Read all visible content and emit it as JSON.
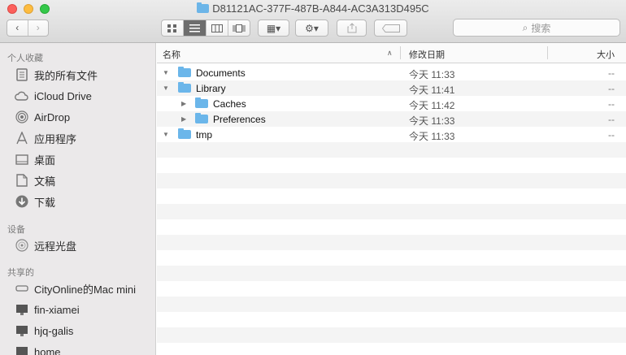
{
  "window": {
    "title": "D81121AC-377F-487B-A844-AC3A313D495C"
  },
  "toolbar": {
    "back": "‹",
    "forward": "›",
    "view_icon": "☰",
    "arrange_label": "▦▾",
    "action_label": "⚙▾",
    "search_placeholder": "搜索"
  },
  "sidebar": {
    "favorites_heading": "个人收藏",
    "favorites": [
      {
        "label": "我的所有文件",
        "icon": "all-files-icon"
      },
      {
        "label": "iCloud Drive",
        "icon": "cloud-icon"
      },
      {
        "label": "AirDrop",
        "icon": "airdrop-icon"
      },
      {
        "label": "应用程序",
        "icon": "applications-icon"
      },
      {
        "label": "桌面",
        "icon": "desktop-icon"
      },
      {
        "label": "文稿",
        "icon": "documents-icon"
      },
      {
        "label": "下载",
        "icon": "download-icon"
      }
    ],
    "devices_heading": "设备",
    "devices": [
      {
        "label": "远程光盘",
        "icon": "disc-icon"
      }
    ],
    "shared_heading": "共享的",
    "shared": [
      {
        "label": "CityOnline的Mac mini",
        "icon": "mac-mini-icon"
      },
      {
        "label": "fin-xiamei",
        "icon": "monitor-icon"
      },
      {
        "label": "hjq-galis",
        "icon": "monitor-icon"
      },
      {
        "label": "home",
        "icon": "monitor-icon"
      }
    ]
  },
  "columns": {
    "name": "名称",
    "date": "修改日期",
    "size": "大小"
  },
  "files": [
    {
      "name": "Documents",
      "date": "今天 11:33",
      "size": "--"
    },
    {
      "name": "Library",
      "date": "今天 11:41",
      "size": "--"
    },
    {
      "name": "Caches",
      "date": "今天 11:42",
      "size": "--"
    },
    {
      "name": "Preferences",
      "date": "今天 11:33",
      "size": "--"
    },
    {
      "name": "tmp",
      "date": "今天 11:33",
      "size": "--"
    }
  ]
}
